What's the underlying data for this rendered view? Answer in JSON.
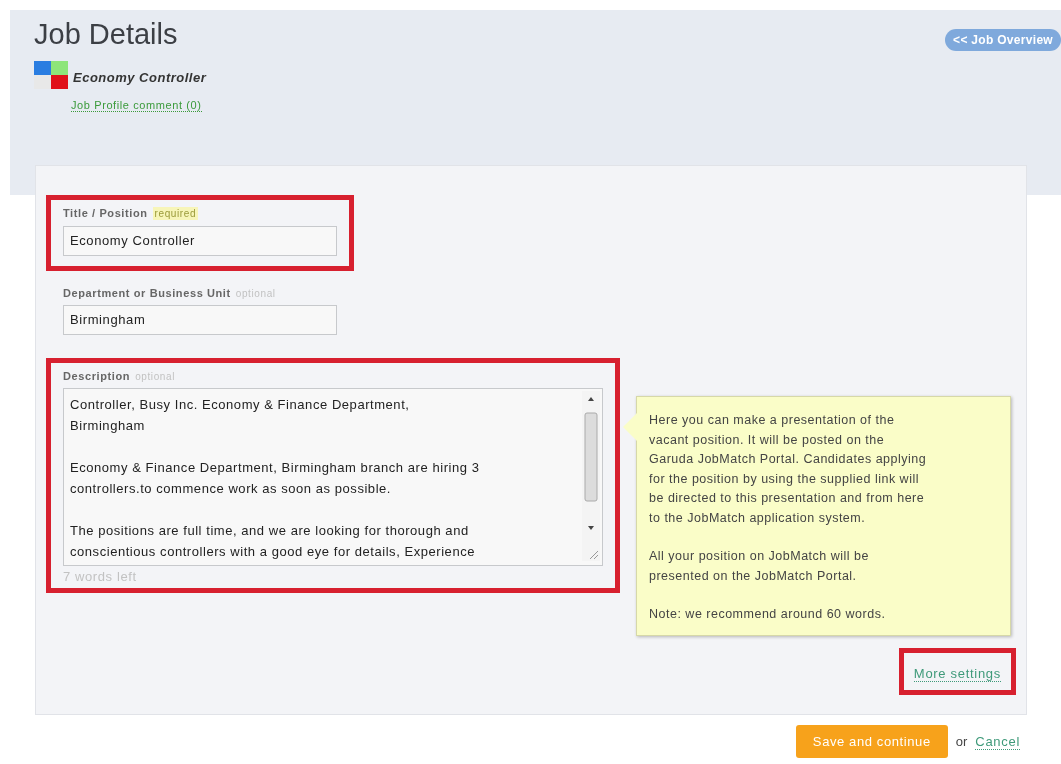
{
  "header": {
    "title": "Job Details",
    "job_name": "Economy Controller",
    "comment_link": "Job Profile comment (0)",
    "overview_button": "<< Job Overview"
  },
  "fields": [
    {
      "kind": "input",
      "label": "Title / Position",
      "tag": "required",
      "value": "Economy Controller",
      "highlighted": true
    },
    {
      "kind": "input",
      "label": "Department or Business Unit",
      "tag": "optional",
      "value": "Birmingham",
      "highlighted": false
    },
    {
      "kind": "textarea",
      "label": "Description",
      "tag": "optional",
      "paragraphs": [
        [
          "Controller, Busy Inc. Economy & Finance Department,",
          "Birmingham"
        ],
        [
          "Economy & Finance Department, Birmingham branch are hiring 3",
          "controllers.to commence work as soon as possible."
        ],
        [
          "The positions are full time, and we are looking for thorough and",
          "conscientious controllers with a good eye for details, Experience"
        ]
      ],
      "counter": "7 words left",
      "highlighted": true
    }
  ],
  "tooltip": {
    "paragraphs": [
      [
        "Here you can make a presentation of the",
        "vacant position. It will be posted on the",
        "Garuda JobMatch Portal. Candidates applying",
        "for the position by using the supplied link will",
        "be directed to this presentation and from here",
        "to the JobMatch application system."
      ],
      [
        "All your position on JobMatch will be",
        "presented on the JobMatch Portal."
      ],
      [
        "Note: we recommend around 60 words."
      ]
    ]
  },
  "more_settings": {
    "label": "More settings",
    "highlighted": true
  },
  "actions": {
    "save": "Save and continue",
    "or": "or",
    "cancel": "Cancel"
  }
}
